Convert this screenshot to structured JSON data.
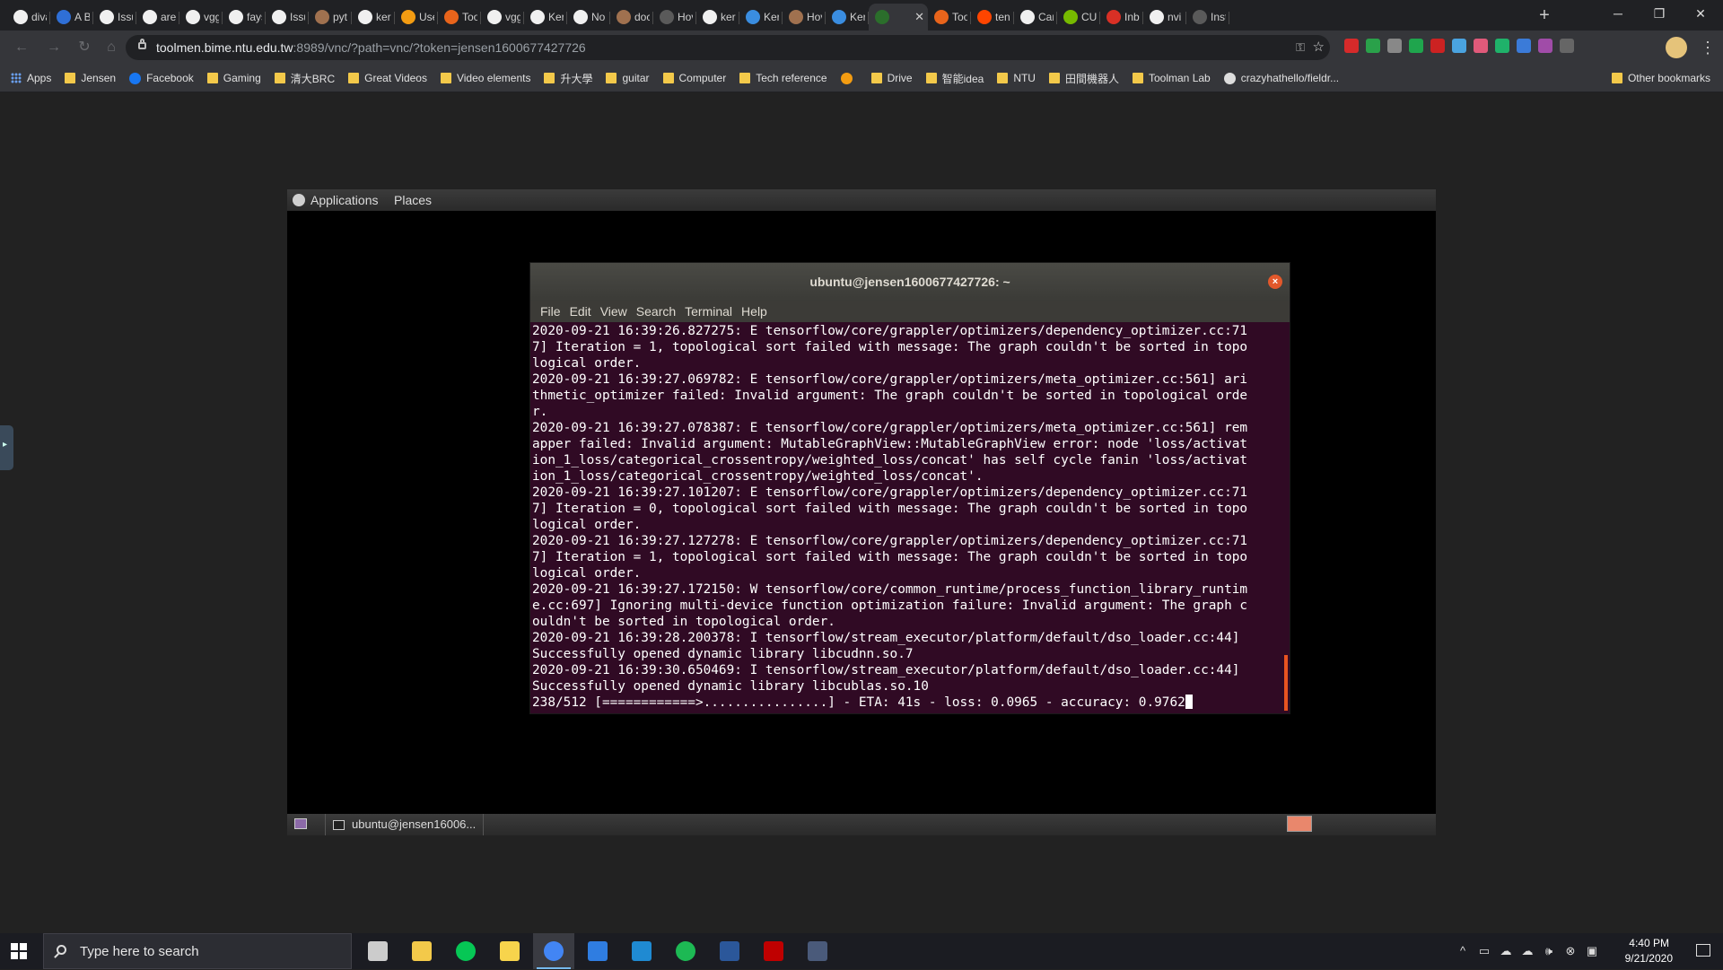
{
  "browser": {
    "tabs": [
      {
        "title": "diva",
        "icon": "github-icon",
        "color": "#f0f0f0"
      },
      {
        "title": "A Bi",
        "icon": "d-icon",
        "color": "#2f6fd6"
      },
      {
        "title": "Issu",
        "icon": "github-icon",
        "color": "#f0f0f0"
      },
      {
        "title": "are",
        "icon": "github-icon",
        "color": "#f0f0f0"
      },
      {
        "title": "vgg",
        "icon": "google-icon",
        "color": "#f0f0f0"
      },
      {
        "title": "fays",
        "icon": "github-icon",
        "color": "#f0f0f0"
      },
      {
        "title": "Issu",
        "icon": "github-icon",
        "color": "#f0f0f0"
      },
      {
        "title": "pyt",
        "icon": "pypi-icon",
        "color": "#a0714f"
      },
      {
        "title": "ker",
        "icon": "google-icon",
        "color": "#f0f0f0"
      },
      {
        "title": "Use",
        "icon": "tensorflow-icon",
        "color": "#f39c12"
      },
      {
        "title": "Too",
        "icon": "gear-icon",
        "color": "#e8641b"
      },
      {
        "title": "vgg",
        "icon": "google-icon",
        "color": "#f0f0f0"
      },
      {
        "title": "Ker",
        "icon": "google-icon",
        "color": "#f0f0f0"
      },
      {
        "title": "No",
        "icon": "github-icon",
        "color": "#f0f0f0"
      },
      {
        "title": "doc",
        "icon": "pypi-icon",
        "color": "#a0714f"
      },
      {
        "title": "Hov",
        "icon": "generic-icon",
        "color": "#5a5a5a"
      },
      {
        "title": "ker",
        "icon": "google-icon",
        "color": "#f0f0f0"
      },
      {
        "title": "Ker",
        "icon": "p-icon",
        "color": "#3a8de0"
      },
      {
        "title": "Hov",
        "icon": "pypi-icon",
        "color": "#a0714f"
      },
      {
        "title": "Ker",
        "icon": "p-icon",
        "color": "#3a8de0"
      },
      {
        "title": "",
        "icon": "vnc-icon",
        "color": "#2b6e2b",
        "active": true
      },
      {
        "title": "Too",
        "icon": "gear-icon",
        "color": "#e8641b"
      },
      {
        "title": "ten",
        "icon": "reddit-icon",
        "color": "#ff4500"
      },
      {
        "title": "Car",
        "icon": "github-icon",
        "color": "#f0f0f0"
      },
      {
        "title": "CU",
        "icon": "nvidia-icon",
        "color": "#76b900"
      },
      {
        "title": "Inb",
        "icon": "gmail-icon",
        "color": "#d93025"
      },
      {
        "title": "nvi",
        "icon": "google-icon",
        "color": "#f0f0f0"
      },
      {
        "title": "Inst",
        "icon": "generic-icon",
        "color": "#5a5a5a"
      }
    ],
    "new_tab_label": "+",
    "window_controls": {
      "minimize": "─",
      "restore": "❐",
      "close": "✕"
    },
    "url_host": "toolmen.bime.ntu.edu.tw",
    "url_rest": ":8989/vnc/?path=vnc/?token=jensen1600677427726",
    "extensions": [
      "#d62a2a",
      "#2aa14a",
      "#888888",
      "#1fa54d",
      "#cc2222",
      "#4aa3df",
      "#e05a7a",
      "#1fb26a",
      "#3b7bd8",
      "#a04ca8",
      "#666666"
    ],
    "bookmarks": [
      {
        "label": "Apps",
        "icon": "apps-icon"
      },
      {
        "label": "Jensen",
        "icon": "folder-icon"
      },
      {
        "label": "Facebook",
        "icon": "facebook-icon"
      },
      {
        "label": "Gaming",
        "icon": "folder-icon"
      },
      {
        "label": "清大BRC",
        "icon": "folder-icon"
      },
      {
        "label": "Great Videos",
        "icon": "folder-icon"
      },
      {
        "label": "Video elements",
        "icon": "folder-icon"
      },
      {
        "label": "升大學",
        "icon": "folder-icon"
      },
      {
        "label": "guitar",
        "icon": "folder-icon"
      },
      {
        "label": "Computer",
        "icon": "folder-icon"
      },
      {
        "label": "Tech reference",
        "icon": "folder-icon"
      },
      {
        "label": "",
        "icon": "tensorflow-icon"
      },
      {
        "label": "Drive",
        "icon": "folder-icon"
      },
      {
        "label": "智能idea",
        "icon": "folder-icon"
      },
      {
        "label": "NTU",
        "icon": "folder-icon"
      },
      {
        "label": "田間機器人",
        "icon": "folder-icon"
      },
      {
        "label": "Toolman Lab",
        "icon": "folder-icon"
      },
      {
        "label": "crazyhathello/fieldr...",
        "icon": "github-icon"
      }
    ],
    "other_bookmarks": "Other bookmarks"
  },
  "vnc": {
    "gnome_top": {
      "applications": "Applications",
      "places": "Places"
    },
    "terminal": {
      "title": "ubuntu@jensen1600677427726: ~",
      "menu": [
        "File",
        "Edit",
        "View",
        "Search",
        "Terminal",
        "Help"
      ],
      "lines": [
        "2020-09-21 16:39:26.827275: E tensorflow/core/grappler/optimizers/dependency_optimizer.cc:71",
        "7] Iteration = 1, topological sort failed with message: The graph couldn't be sorted in topo",
        "logical order.",
        "2020-09-21 16:39:27.069782: E tensorflow/core/grappler/optimizers/meta_optimizer.cc:561] ari",
        "thmetic_optimizer failed: Invalid argument: The graph couldn't be sorted in topological orde",
        "r.",
        "2020-09-21 16:39:27.078387: E tensorflow/core/grappler/optimizers/meta_optimizer.cc:561] rem",
        "apper failed: Invalid argument: MutableGraphView::MutableGraphView error: node 'loss/activat",
        "ion_1_loss/categorical_crossentropy/weighted_loss/concat' has self cycle fanin 'loss/activat",
        "ion_1_loss/categorical_crossentropy/weighted_loss/concat'.",
        "2020-09-21 16:39:27.101207: E tensorflow/core/grappler/optimizers/dependency_optimizer.cc:71",
        "7] Iteration = 0, topological sort failed with message: The graph couldn't be sorted in topo",
        "logical order.",
        "2020-09-21 16:39:27.127278: E tensorflow/core/grappler/optimizers/dependency_optimizer.cc:71",
        "7] Iteration = 1, topological sort failed with message: The graph couldn't be sorted in topo",
        "logical order.",
        "2020-09-21 16:39:27.172150: W tensorflow/core/common_runtime/process_function_library_runtim",
        "e.cc:697] Ignoring multi-device function optimization failure: Invalid argument: The graph c",
        "ouldn't be sorted in topological order.",
        "2020-09-21 16:39:28.200378: I tensorflow/stream_executor/platform/default/dso_loader.cc:44]",
        "Successfully opened dynamic library libcudnn.so.7",
        "2020-09-21 16:39:30.650469: I tensorflow/stream_executor/platform/default/dso_loader.cc:44]",
        "Successfully opened dynamic library libcublas.so.10"
      ],
      "progress_line": "238/512 [============>................] - ETA: 41s - loss: 0.0965 - accuracy: 0.9762"
    },
    "gnome_bottom": {
      "task_label": "ubuntu@jensen16006..."
    }
  },
  "taskbar": {
    "search_placeholder": "Type here to search",
    "apps": [
      {
        "name": "task-view-icon",
        "color": "#cccccc"
      },
      {
        "name": "file-explorer-icon",
        "color": "#f3c94a"
      },
      {
        "name": "line-icon",
        "color": "#06c755"
      },
      {
        "name": "sticky-notes-icon",
        "color": "#f7d44c"
      },
      {
        "name": "chrome-icon",
        "color": "#4285f4",
        "active": true
      },
      {
        "name": "todo-icon",
        "color": "#2f7de1"
      },
      {
        "name": "vscode-icon",
        "color": "#1f8ad2"
      },
      {
        "name": "spotify-icon",
        "color": "#1db954"
      },
      {
        "name": "word-icon",
        "color": "#2b579a"
      },
      {
        "name": "filezilla-icon",
        "color": "#bf0000"
      },
      {
        "name": "calculator-icon",
        "color": "#4a5a7a"
      }
    ],
    "clock_time": "4:40 PM",
    "clock_date": "9/21/2020"
  }
}
